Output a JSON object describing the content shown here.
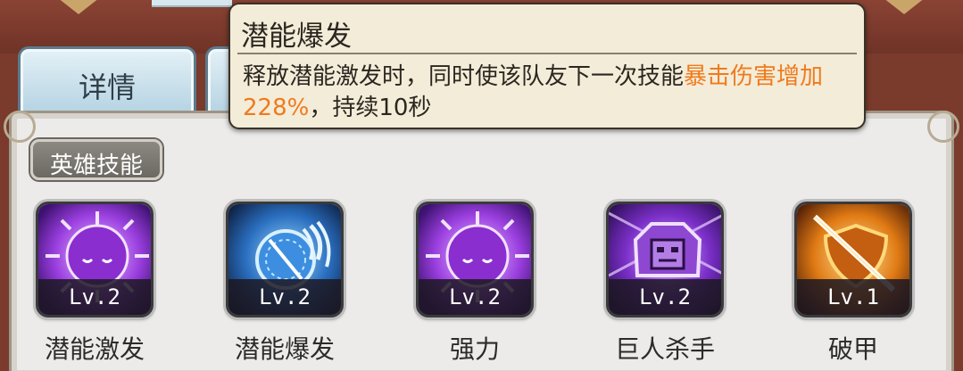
{
  "tabs": [
    {
      "label": "详情"
    },
    {
      "label": ""
    }
  ],
  "section": {
    "label": "英雄技能"
  },
  "tooltip": {
    "title": "潜能爆发",
    "body_pre": "释放潜能激发时，同时使该队友下一次技能",
    "body_highlight": "暴击伤害增加228%",
    "body_post": "，持续10秒",
    "highlight_color": "#f07a1c"
  },
  "skills": [
    {
      "name": "潜能激发",
      "level": "Lv.2",
      "icon": "purple-sun-icon"
    },
    {
      "name": "潜能爆发",
      "level": "Lv.2",
      "icon": "blue-compass-claw-icon"
    },
    {
      "name": "强力",
      "level": "Lv.2",
      "icon": "purple-sun-icon"
    },
    {
      "name": "巨人杀手",
      "level": "Lv.2",
      "icon": "stone-golem-icon"
    },
    {
      "name": "破甲",
      "level": "Lv.1",
      "icon": "broken-shield-icon"
    }
  ],
  "colors": {
    "background": "#7a3a2c",
    "panel": "#ecebea",
    "tooltip": "#f3ecd8",
    "highlight": "#f07a1c"
  }
}
